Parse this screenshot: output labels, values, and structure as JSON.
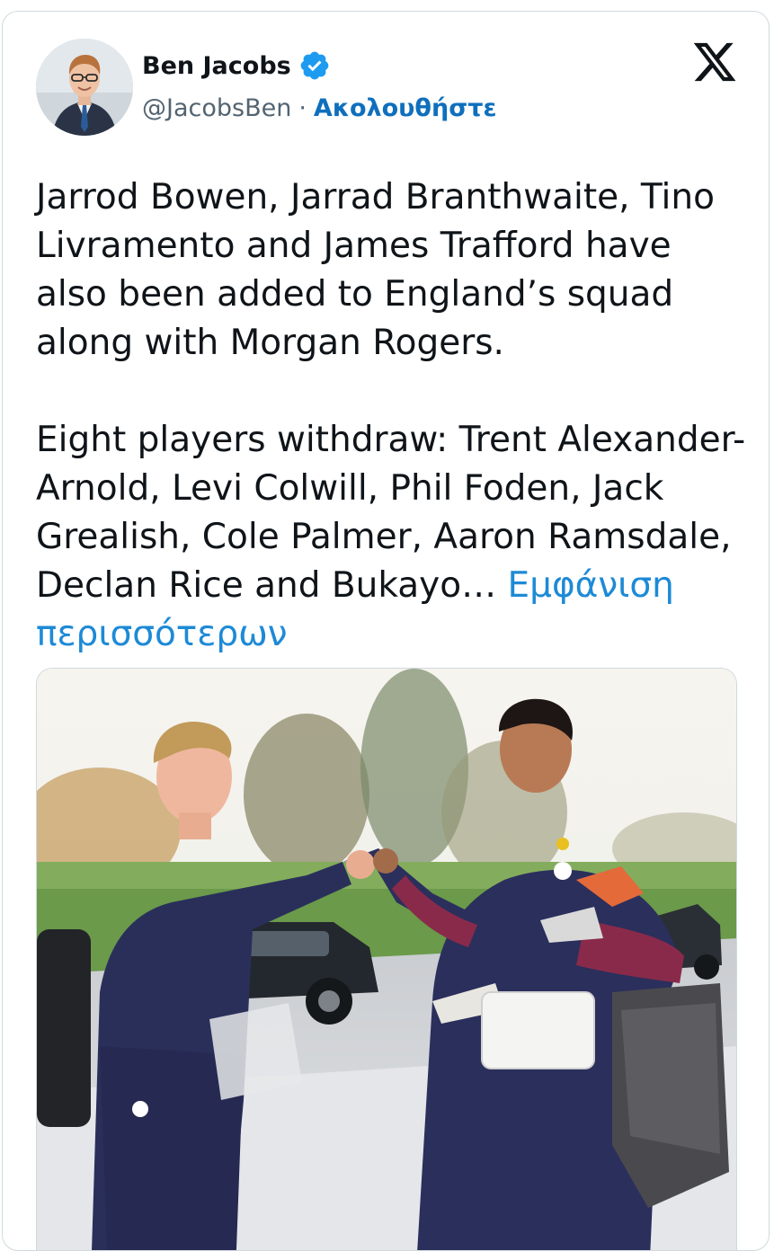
{
  "author": {
    "display_name": "Ben Jacobs",
    "handle": "@JacobsBen",
    "separator": "·",
    "follow_label": "Ακολουθήστε",
    "verified": true
  },
  "tweet": {
    "paragraph_1": "Jarrod Bowen, Jarrad Branthwaite, Tino Livramento and James Trafford have also been added to England’s squad along with Morgan Rogers.",
    "paragraph_2": "Eight players withdraw: Trent Alexander-Arnold, Levi Colwill, Phil Foden, Jack Grealish, Cole Palmer, Aaron Ramsdale, Declan Rice and Bukayo…",
    "show_more_label": "Εμφάνιση περισσότερων"
  },
  "icons": {
    "verified": "verified-badge-icon",
    "platform": "x-logo-icon"
  },
  "colors": {
    "text": "#0f1419",
    "secondary_text": "#536471",
    "link": "#1d8ad6",
    "follow": "#0f6fbd",
    "verified": "#1d9bf0",
    "border": "#cfd9de"
  }
}
